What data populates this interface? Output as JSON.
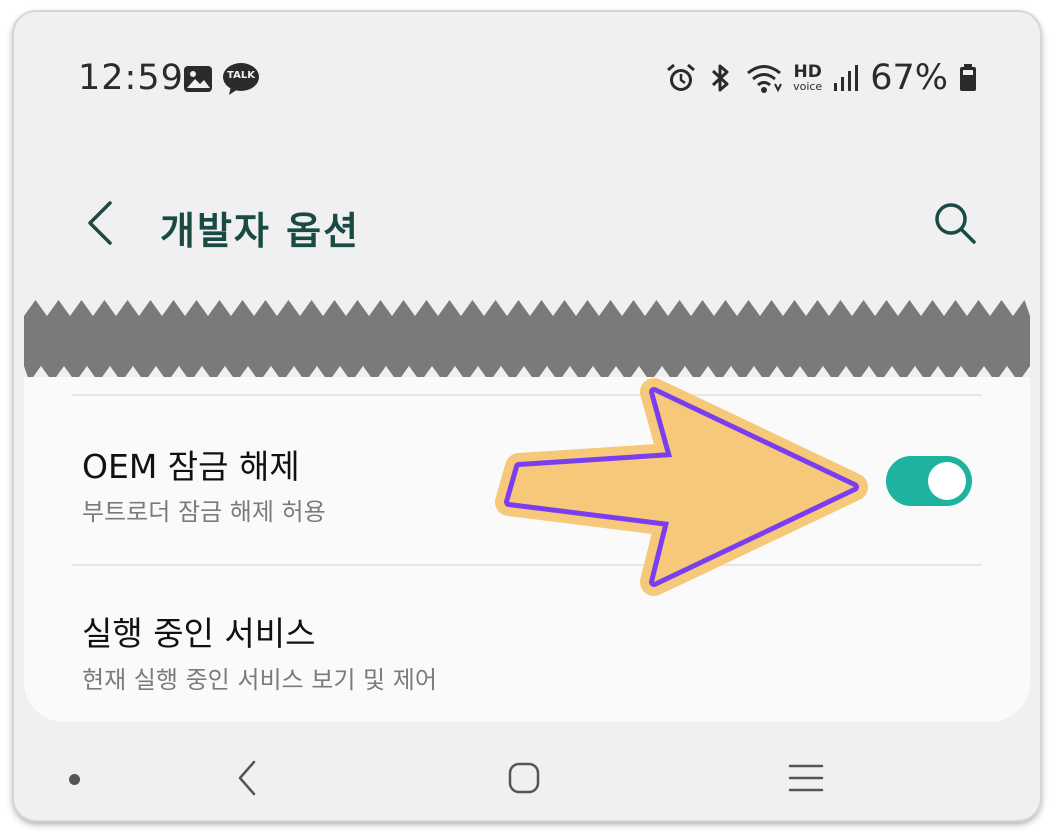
{
  "status_bar": {
    "time": "12:59",
    "left_icons": [
      "gallery-icon",
      "kakaotalk-icon"
    ],
    "talk_badge": "TALK",
    "right_icons": [
      "alarm-icon",
      "bluetooth-icon",
      "wifi-icon",
      "hd-voice-icon",
      "signal-icon",
      "battery-icon"
    ],
    "hd_label": "HD",
    "voice_label": "voice",
    "battery_percent": "67%"
  },
  "header": {
    "title": "개발자 옵션",
    "back_icon": "chevron-left-icon",
    "search_icon": "search-icon"
  },
  "settings": {
    "items": [
      {
        "title": "OEM 잠금 해제",
        "subtitle": "부트로더 잠금 해제 허용",
        "toggle_on": true
      },
      {
        "title": "실행 중인 서비스",
        "subtitle": "현재 실행 중인 서비스 보기 및 제어"
      }
    ]
  },
  "colors": {
    "title_color": "#194a44",
    "toggle_on": "#1db39e",
    "arrow_fill": "#f6c87a",
    "arrow_stroke": "#7a3df0"
  },
  "nav_bar": {
    "icons": [
      "dot-icon",
      "back-icon",
      "home-icon",
      "recents-icon"
    ]
  }
}
